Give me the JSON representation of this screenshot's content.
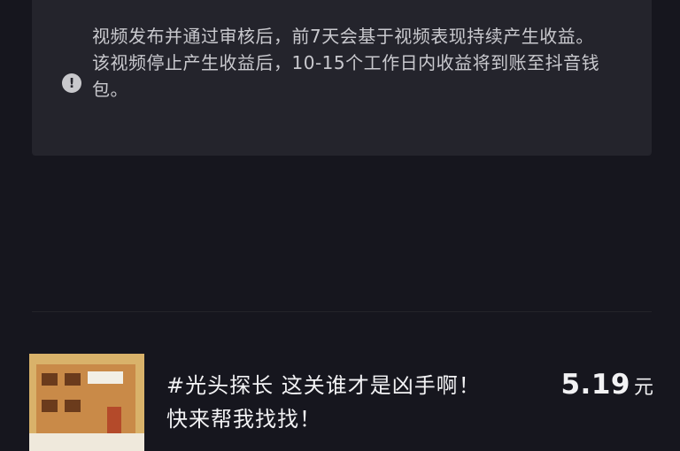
{
  "notice": {
    "icon": "exclamation-circle-icon",
    "line1": "视频发布并通过审核后，前7天会基于视频表现持续产生收益。",
    "line2": "该视频停止产生收益后，10-15个工作日内收益将到账至抖音钱包。"
  },
  "video": {
    "title": "#光头探长 这关谁才是凶手啊！快来帮我找找！",
    "earning_amount": "5.19",
    "earning_unit": "元"
  }
}
